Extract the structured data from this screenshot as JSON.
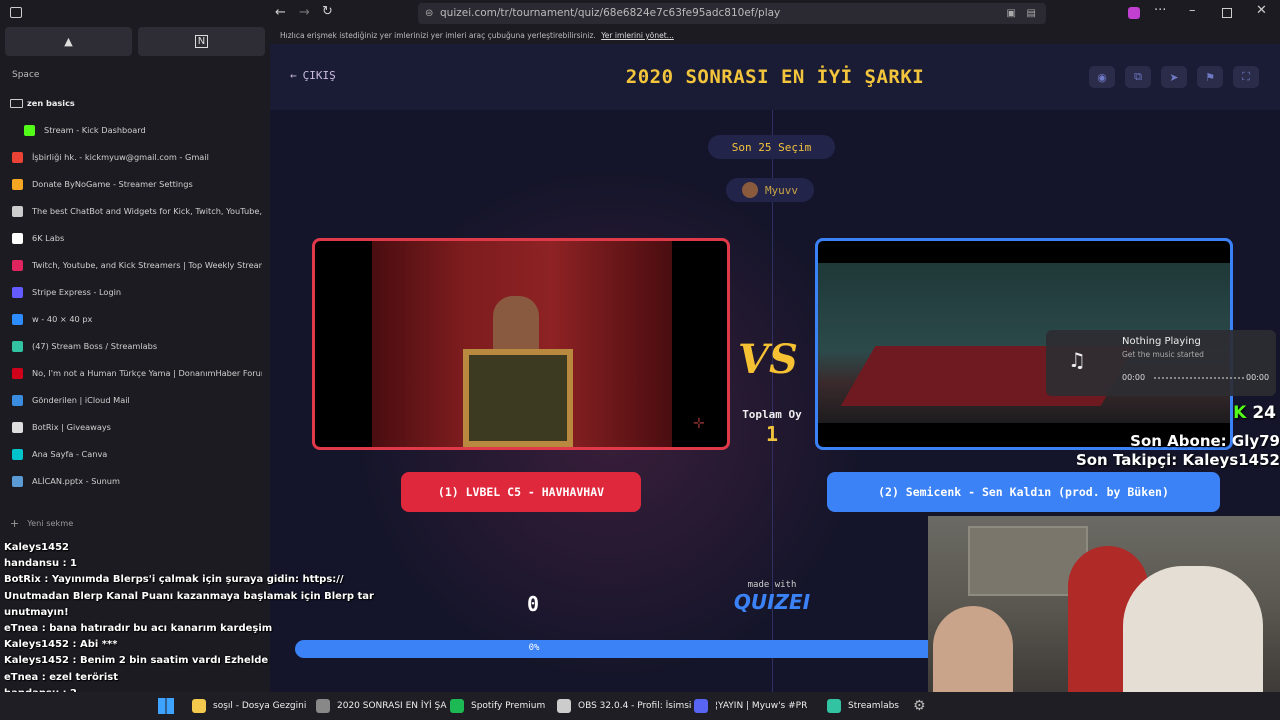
{
  "browser": {
    "url": "quizei.com/tr/tournament/quiz/68e6824e7c63fe95adc810ef/play",
    "bookmark_hint": "Hızlıca erişmek istediğiniz yer imlerinizi yer imleri araç çubuğuna yerleştirebilirsiniz.",
    "bookmark_link": "Yer imlerini yönet..."
  },
  "sidebar": {
    "space_label": "Space",
    "folder_label": "zen basics",
    "tabs": [
      {
        "label": "Stream - Kick Dashboard",
        "color": "#53fc18"
      },
      {
        "label": "İşbirliği hk. - kickmyuw@gmail.com - Gmail",
        "color": "#ea4335"
      },
      {
        "label": "Donate ByNoGame - Streamer Settings",
        "color": "#f5a623"
      },
      {
        "label": "The best ChatBot and Widgets for Kick, Twitch, YouTube, T",
        "color": "#cccccc"
      },
      {
        "label": "6K Labs",
        "color": "#ffffff"
      },
      {
        "label": "Twitch, Youtube, and Kick Streamers | Top Weekly Streame",
        "color": "#e0245e"
      },
      {
        "label": "Stripe Express - Login",
        "color": "#635bff"
      },
      {
        "label": "w - 40 × 40 px",
        "color": "#2d8cff"
      },
      {
        "label": "(47) Stream Boss / Streamlabs",
        "color": "#31c3a2"
      },
      {
        "label": "No, I'm not a Human Türkçe Yama | DonanımHaber Forum",
        "color": "#d0021b"
      },
      {
        "label": "Gönderilen | iCloud Mail",
        "color": "#3a8dde"
      },
      {
        "label": "BotRix | Giveaways",
        "color": "#dddddd"
      },
      {
        "label": "Ana Sayfa - Canva",
        "color": "#00c4cc"
      },
      {
        "label": "ALİCAN.pptx - Sunum",
        "color": "#5b9bd5"
      }
    ],
    "new_tab_label": "Yeni sekme"
  },
  "quiz": {
    "exit_label": "ÇIKIŞ",
    "title": "2020 SONRASI EN İYİ ŞARKI",
    "round_label": "Son 25 Seçim",
    "user_label": "Myuvv",
    "vs_total_label": "Toplam Oy",
    "vs_total_value": "1",
    "option_left": "(1) LVBEL C5 - HAVHAVHAV",
    "option_right": "(2) Semicenk - Sen Kaldın (prod. by Büken)",
    "left_count": "0",
    "made_with_label": "made with",
    "brand": "QUIZEI",
    "progress_label": "0%",
    "progress_percent": 0
  },
  "media_widget": {
    "title": "Nothing Playing",
    "subtitle": "Get the music started",
    "time_left": "00:00",
    "time_right": "00:00"
  },
  "overlay": {
    "kick_count": "24",
    "last_sub": "Son Abone: Gly79",
    "last_follower": "Son Takipçi: Kaleys1452"
  },
  "chat": [
    {
      "user": "Kaleys1452",
      "msg": ""
    },
    {
      "user": "handansu",
      "msg": ": 1"
    },
    {
      "user": "BotRix",
      "msg": ": Yayınımda Blerps'i çalmak için şuraya gidin: https://"
    },
    {
      "user": "",
      "msg": "Unutmadan Blerp Kanal Puanı kazanmaya başlamak için Blerp tar"
    },
    {
      "user": "",
      "msg": "unutmayın!"
    },
    {
      "user": "eTnea",
      "msg": ": bana hatıradır bu acı kanarım kardeşim"
    },
    {
      "user": "Kaleys1452",
      "msg": ": Abi ***"
    },
    {
      "user": "Kaleys1452",
      "msg": ": Benim 2 bin saatim vardı Ezhelde"
    },
    {
      "user": "eTnea",
      "msg": ": ezel terörist"
    },
    {
      "user": "handansu",
      "msg": ": 2"
    }
  ],
  "taskbar": [
    {
      "label": "soşıl - Dosya Gezgini",
      "color": "#f2c94c"
    },
    {
      "label": "2020 SONRASI EN İYİ ŞA",
      "color": "#888888"
    },
    {
      "label": "Spotify Premium",
      "color": "#1db954"
    },
    {
      "label": "OBS 32.0.4 - Profil: İsimsi",
      "color": "#cccccc"
    },
    {
      "label": "¦YAYIN | Myuw's #PR",
      "color": "#5865f2"
    },
    {
      "label": "Streamlabs",
      "color": "#31c3a2"
    }
  ]
}
